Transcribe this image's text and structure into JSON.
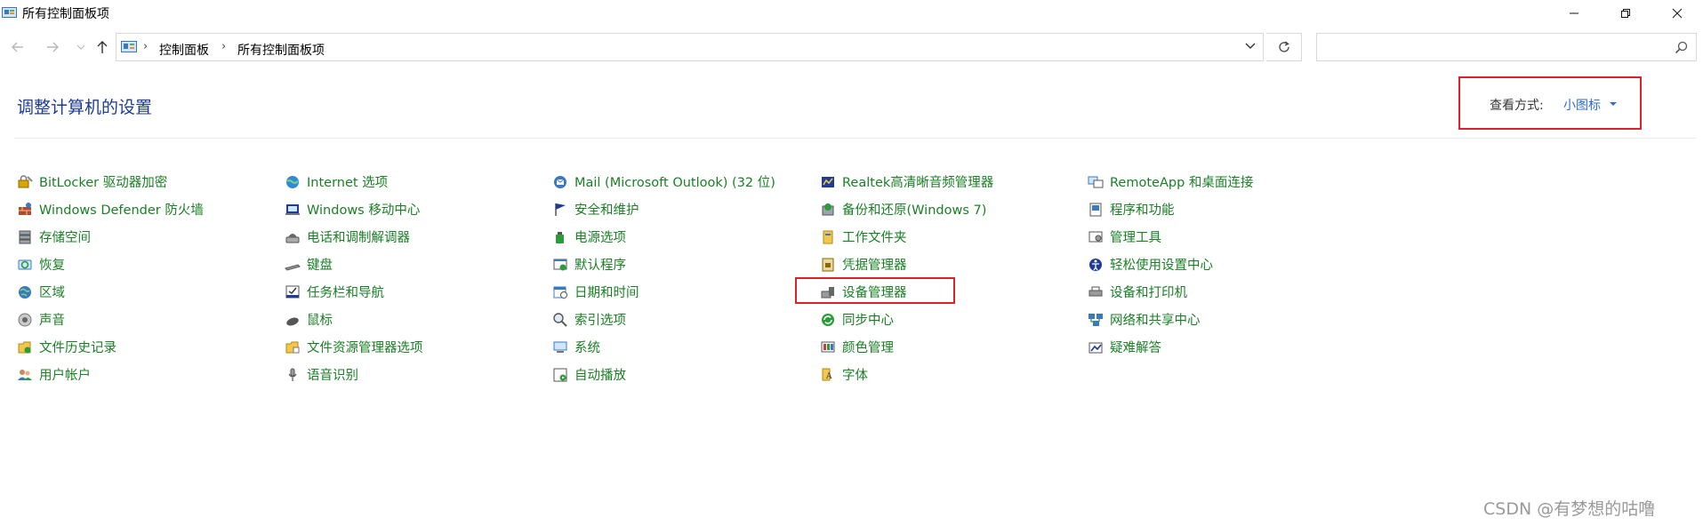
{
  "window": {
    "title": "所有控制面板项",
    "controls": {
      "minimize": "minimize-icon",
      "maximize": "restore-icon",
      "close": "close-icon"
    }
  },
  "nav": {
    "breadcrumb": [
      "控制面板",
      "所有控制面板项"
    ],
    "search_placeholder": ""
  },
  "header": {
    "heading": "调整计算机的设置",
    "view_by_label": "查看方式:",
    "view_by_value": "小图标"
  },
  "colors": {
    "link": "#1a7f25",
    "heading": "#1e3b96",
    "accent": "#2e6bd6",
    "highlight": "#e0202a"
  },
  "items": [
    [
      {
        "label": "BitLocker 驱动器加密",
        "icon": "bitlocker-icon"
      },
      {
        "label": "Windows Defender 防火墙",
        "icon": "firewall-icon"
      },
      {
        "label": "存储空间",
        "icon": "storage-spaces-icon"
      },
      {
        "label": "恢复",
        "icon": "recovery-icon"
      },
      {
        "label": "区域",
        "icon": "region-icon"
      },
      {
        "label": "声音",
        "icon": "sound-icon"
      },
      {
        "label": "文件历史记录",
        "icon": "file-history-icon"
      },
      {
        "label": "用户帐户",
        "icon": "user-accounts-icon"
      }
    ],
    [
      {
        "label": "Internet 选项",
        "icon": "internet-options-icon"
      },
      {
        "label": "Windows 移动中心",
        "icon": "mobility-center-icon"
      },
      {
        "label": "电话和调制解调器",
        "icon": "phone-modem-icon"
      },
      {
        "label": "键盘",
        "icon": "keyboard-icon"
      },
      {
        "label": "任务栏和导航",
        "icon": "taskbar-icon"
      },
      {
        "label": "鼠标",
        "icon": "mouse-icon"
      },
      {
        "label": "文件资源管理器选项",
        "icon": "folder-options-icon"
      },
      {
        "label": "语音识别",
        "icon": "microphone-icon"
      }
    ],
    [
      {
        "label": "Mail (Microsoft Outlook) (32 位)",
        "icon": "mail-icon"
      },
      {
        "label": "安全和维护",
        "icon": "security-flag-icon"
      },
      {
        "label": "电源选项",
        "icon": "power-options-icon"
      },
      {
        "label": "默认程序",
        "icon": "default-programs-icon"
      },
      {
        "label": "日期和时间",
        "icon": "date-time-icon"
      },
      {
        "label": "索引选项",
        "icon": "indexing-icon"
      },
      {
        "label": "系统",
        "icon": "system-icon"
      },
      {
        "label": "自动播放",
        "icon": "autoplay-icon"
      }
    ],
    [
      {
        "label": "Realtek高清晰音频管理器",
        "icon": "realtek-audio-icon"
      },
      {
        "label": "备份和还原(Windows 7)",
        "icon": "backup-restore-icon"
      },
      {
        "label": "工作文件夹",
        "icon": "work-folders-icon"
      },
      {
        "label": "凭据管理器",
        "icon": "credential-manager-icon"
      },
      {
        "label": "设备管理器",
        "icon": "device-manager-icon"
      },
      {
        "label": "同步中心",
        "icon": "sync-center-icon"
      },
      {
        "label": "颜色管理",
        "icon": "color-management-icon"
      },
      {
        "label": "字体",
        "icon": "fonts-icon"
      }
    ],
    [
      {
        "label": "RemoteApp 和桌面连接",
        "icon": "remoteapp-icon"
      },
      {
        "label": "程序和功能",
        "icon": "programs-features-icon"
      },
      {
        "label": "管理工具",
        "icon": "admin-tools-icon"
      },
      {
        "label": "轻松使用设置中心",
        "icon": "ease-of-access-icon"
      },
      {
        "label": "设备和打印机",
        "icon": "devices-printers-icon"
      },
      {
        "label": "网络和共享中心",
        "icon": "network-sharing-icon"
      },
      {
        "label": "疑难解答",
        "icon": "troubleshooting-icon"
      }
    ]
  ],
  "watermark": "CSDN @有梦想的咕噜"
}
